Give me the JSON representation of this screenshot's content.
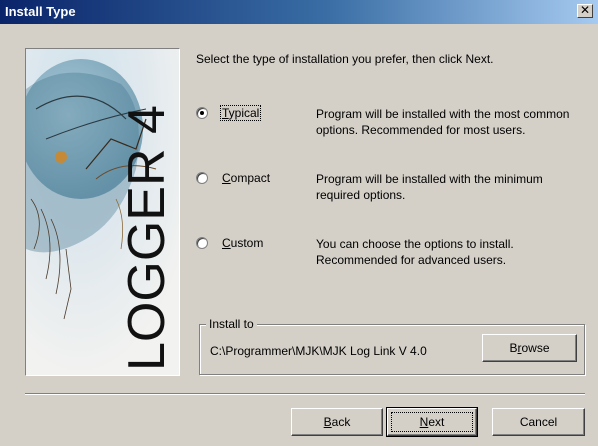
{
  "window": {
    "title": "Install Type",
    "close_glyph": "✕"
  },
  "side_image": {
    "brand_text": "LOGGER 4"
  },
  "instruction": "Select the type of installation you prefer, then click Next.",
  "options": [
    {
      "label": "Typical",
      "mnemonic": "T",
      "rest": "ypical",
      "selected": true,
      "description": "Program will be installed with the most common options. Recommended for most users."
    },
    {
      "label": "Compact",
      "mnemonic": "C",
      "rest": "ompact",
      "selected": false,
      "description": "Program will be installed with the minimum required options."
    },
    {
      "label": "Custom",
      "mnemonic": "C",
      "rest": "ustom",
      "selected": false,
      "description": "You can choose the options to install. Recommended for advanced users."
    }
  ],
  "install_to": {
    "legend": "Install to",
    "path": "C:\\Programmer\\MJK\\MJK Log Link V 4.0",
    "browse_pre": "B",
    "browse_mnemonic": "r",
    "browse_post": "owse"
  },
  "buttons": {
    "back_mnemonic": "B",
    "back_rest": "ack",
    "next_mnemonic": "N",
    "next_rest": "ext",
    "cancel": "Cancel"
  }
}
